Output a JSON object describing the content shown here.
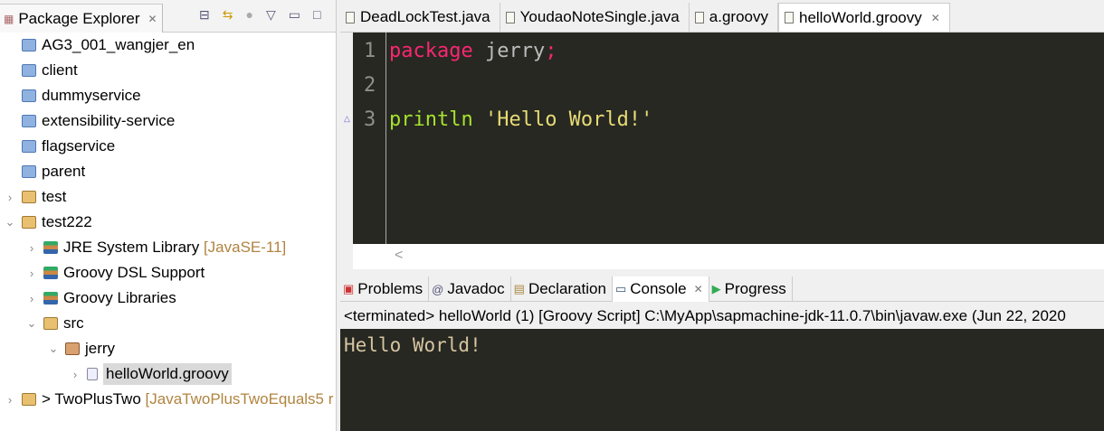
{
  "explorer": {
    "title": "Package Explorer",
    "items": [
      {
        "label": "AG3_001_wangjer_en",
        "depth": 0,
        "twisty": "",
        "icon": "folder"
      },
      {
        "label": "client",
        "depth": 0,
        "twisty": "",
        "icon": "folder"
      },
      {
        "label": "dummyservice",
        "depth": 0,
        "twisty": "",
        "icon": "folder"
      },
      {
        "label": "extensibility-service",
        "depth": 0,
        "twisty": "",
        "icon": "folder"
      },
      {
        "label": "flagservice",
        "depth": 0,
        "twisty": "",
        "icon": "folder"
      },
      {
        "label": "parent",
        "depth": 0,
        "twisty": "",
        "icon": "folder"
      },
      {
        "label": "test",
        "depth": 0,
        "twisty": ">",
        "icon": "proj"
      },
      {
        "label": "test222",
        "depth": 0,
        "twisty": "v",
        "icon": "proj"
      },
      {
        "label": "JRE System Library",
        "decoration": "[JavaSE-11]",
        "depth": 1,
        "twisty": ">",
        "icon": "lib"
      },
      {
        "label": "Groovy DSL Support",
        "depth": 1,
        "twisty": ">",
        "icon": "lib"
      },
      {
        "label": "Groovy Libraries",
        "depth": 1,
        "twisty": ">",
        "icon": "lib"
      },
      {
        "label": "src",
        "depth": 1,
        "twisty": "v",
        "icon": "proj"
      },
      {
        "label": "jerry",
        "depth": 2,
        "twisty": "v",
        "icon": "pkg"
      },
      {
        "label": "helloWorld.groovy",
        "depth": 3,
        "twisty": ">",
        "icon": "gfile",
        "selected": true
      },
      {
        "label": "> TwoPlusTwo",
        "decoration": "[JavaTwoPlusTwoEquals5 r",
        "depth": 0,
        "twisty": ">",
        "icon": "proj"
      }
    ]
  },
  "editor": {
    "tabs": [
      "DeadLockTest.java",
      "YoudaoNoteSingle.java",
      "a.groovy",
      "helloWorld.groovy"
    ],
    "active_tab": 3,
    "lines": {
      "n1": "1",
      "n2": "2",
      "n3": "3",
      "l1_kw": "package",
      "l1_rest": " jerry",
      "l1_semi": ";",
      "l3_fn": "println",
      "l3_str": " 'Hello World!'"
    }
  },
  "bottom": {
    "tabs": [
      "Problems",
      "Javadoc",
      "Declaration",
      "Console",
      "Progress"
    ],
    "active_tab": 3,
    "console_info": "<terminated> helloWorld (1) [Groovy Script] C:\\MyApp\\sapmachine-jdk-11.0.7\\bin\\javaw.exe (Jun 22, 2020",
    "output": "Hello World!"
  }
}
